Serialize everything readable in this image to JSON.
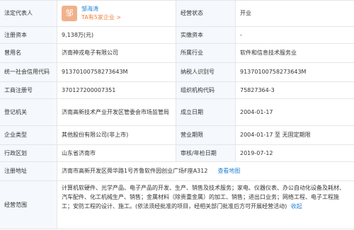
{
  "legal_rep": {
    "label": "法定代表人",
    "avatar_char": "邹",
    "name": "邹海涛",
    "related": "TA有5家企业 >"
  },
  "status": {
    "label": "经营状态",
    "value": "开业"
  },
  "reg_capital": {
    "label": "注册资本",
    "value": "9,138万(元)"
  },
  "paid_capital": {
    "label": "实缴资本",
    "value": "-"
  },
  "former_name": {
    "label": "曾用名",
    "value": "济南神戎电子有限公司"
  },
  "industry": {
    "label": "所属行业",
    "value": "软件和信息技术服务业"
  },
  "credit_code": {
    "label": "统一社会信用代码",
    "value": "91370100758273643M"
  },
  "taxpayer_id": {
    "label": "纳税人识别号",
    "value": "91370100758273643M"
  },
  "reg_number": {
    "label": "工商注册号",
    "value": "370127200007351"
  },
  "org_code": {
    "label": "组织机构代码",
    "value": "75827364-3"
  },
  "reg_authority": {
    "label": "登记机关",
    "value": "济南高新技术产业开发区管委会市场监管局"
  },
  "founded": {
    "label": "成立日期",
    "value": "2004-01-17"
  },
  "company_type": {
    "label": "企业类型",
    "value": "其他股份有限公司(非上市)"
  },
  "term": {
    "label": "营业期限",
    "value": "2004-01-17 至 无固定期限"
  },
  "region": {
    "label": "行政区划",
    "value": "山东省济南市"
  },
  "approval": {
    "label": "审核/年检日期",
    "value": "2019-07-12"
  },
  "address": {
    "label": "注册地址",
    "value": "济南市高新开发区舜华路1号齐鲁软件园创业广场F座A312",
    "map_link": "查看地图"
  },
  "scope": {
    "label": "经营范围",
    "value": "计算机软硬件、光学产品、电子产品的开发、生产、销售及技术服务；家电、仪器仪表、办公自动化设备及耗材、汽车配件、化工机械生产、销售；金属材料（除贵重金属）的加工、销售；进出口业务；网络工程、电子工程施工；安防工程的设计、施工。(依法须经批准的项目，经相关部门批准后方可开展经营活动)",
    "collapse_link": "收起"
  }
}
